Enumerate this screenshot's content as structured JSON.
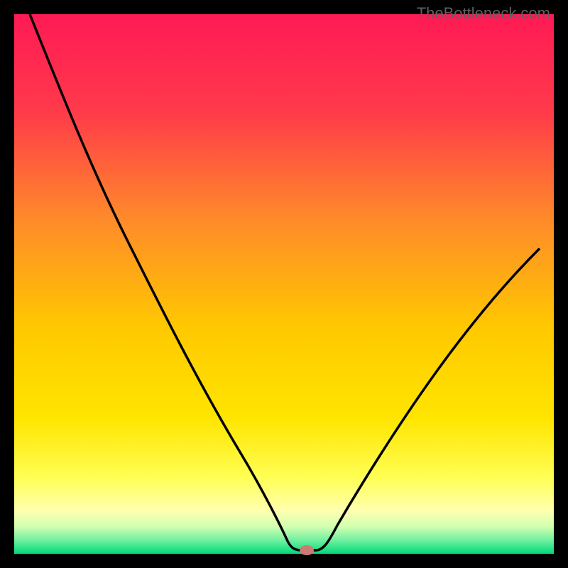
{
  "watermark": "TheBottleneck.com",
  "chart_data": {
    "type": "line",
    "title": "",
    "xlabel": "",
    "ylabel": "",
    "xlim": [
      0,
      100
    ],
    "ylim": [
      0,
      100
    ],
    "minimum_x": 53,
    "curve_points": [
      {
        "x": 3,
        "y": 100
      },
      {
        "x": 10,
        "y": 82
      },
      {
        "x": 20,
        "y": 62
      },
      {
        "x": 30,
        "y": 44
      },
      {
        "x": 40,
        "y": 26
      },
      {
        "x": 48,
        "y": 8
      },
      {
        "x": 50,
        "y": 2
      },
      {
        "x": 51,
        "y": 1
      },
      {
        "x": 55,
        "y": 1
      },
      {
        "x": 58,
        "y": 4
      },
      {
        "x": 65,
        "y": 16
      },
      {
        "x": 75,
        "y": 30
      },
      {
        "x": 85,
        "y": 42
      },
      {
        "x": 97,
        "y": 56
      }
    ],
    "marker": {
      "x": 53,
      "y": 1,
      "color": "#c97b74"
    },
    "background_gradient": {
      "top": "#ff1a55",
      "mid1": "#ff7f2a",
      "mid2": "#ffd500",
      "mid3": "#ffff80",
      "bottom": "#00e080"
    },
    "border": {
      "color": "#000000",
      "width": 20
    }
  }
}
